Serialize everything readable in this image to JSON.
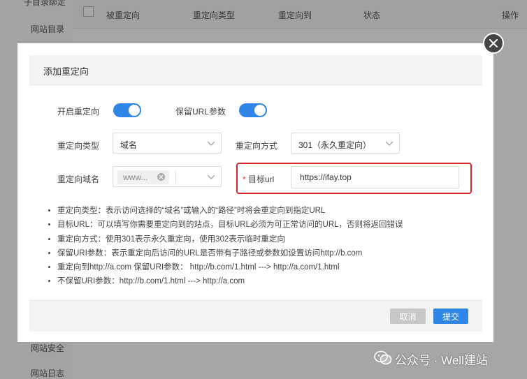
{
  "background": {
    "sidebar": {
      "items": [
        "子目录绑定",
        "网站目录",
        "网站安全",
        "网站日志"
      ]
    },
    "table": {
      "columns": [
        "被重定向",
        "重定向类型",
        "重定向到",
        "状态",
        "操作"
      ]
    }
  },
  "dialog": {
    "title": "添加重定向",
    "enable_redirect_label": "开启重定向",
    "keep_url_params_label": "保留URL参数",
    "enable_redirect_on": true,
    "keep_url_params_on": true,
    "redirect_type_label": "重定向类型",
    "redirect_type_value": "域名",
    "redirect_method_label": "重定向方式",
    "redirect_method_value": "301（永久重定向）",
    "redirect_domain_label": "重定向域名",
    "redirect_domain_tag": "www...",
    "target_url_required": "*",
    "target_url_label": "目标url",
    "target_url_value": "https://ifay.top",
    "notes": [
      "重定向类型：表示访问选择的“域名”或输入的“路径”时将会重定向到指定URL",
      "目标URL：可以填写你需要重定向到的站点，目标URL必须为可正常访问的URL，否则将返回错误",
      "重定向方式：使用301表示永久重定向，使用302表示临时重定向",
      "保留URI参数：表示重定向后访问的URL是否带有子路径或参数如设置访问http://b.com",
      "重定向到http://a.com 保留URI参数： http://b.com/1.html ---> http://a.com/1.html",
      "不保留URI参数：http://b.com/1.html ---> http://a.com"
    ],
    "cancel_label": "取消",
    "submit_label": "提交"
  },
  "watermark": {
    "text": "公众号 · Well建站"
  },
  "colors": {
    "primary": "#2f86e6",
    "highlight": "#d9262c",
    "cancel": "#c7c7c7"
  }
}
